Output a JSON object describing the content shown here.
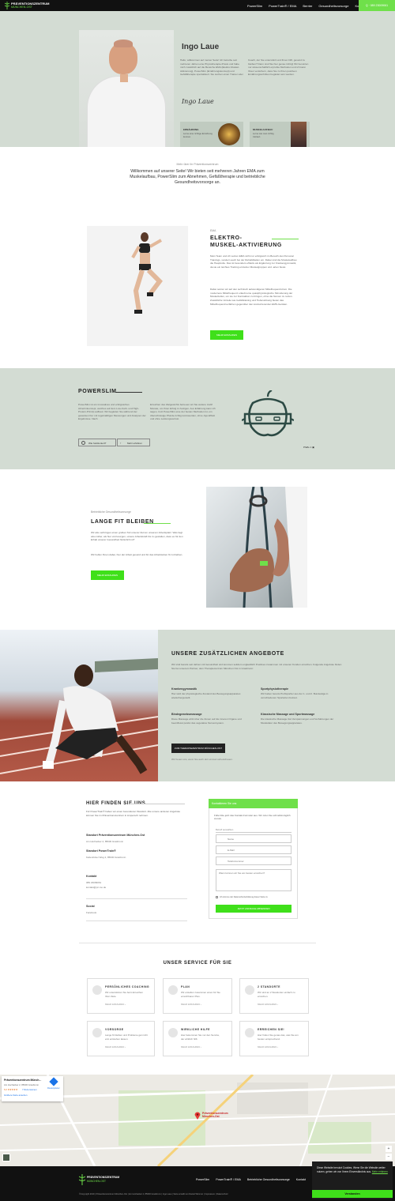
{
  "header": {
    "logo_line1": "PRÄVENTIONSZENTRUM",
    "logo_line2": "MÜNCHEN-OST",
    "nav": [
      "PowerSlim",
      "PowerTrain® / EMA",
      "Berrier",
      "Gesundheitsvorsorge",
      "Kontakt"
    ],
    "phone": "Q · 089 23009061"
  },
  "hero": {
    "name": "Ingo Laue",
    "col1": "Hallo, willkommen auf meiner Seite! Ich betreibe seit mehreren Jahren eine Physiotherapie-Praxis und habe mich zusätzlich auf die Bereiche EMA (Elektro-Muskel-Aktivierung), PowerSlim (Ernährungskonzept) und Gefäßtherapie spezialisiert. Sie suchen einen Trainer oder",
    "col2": "Coach, der Sie unterstützt und Ihnen hilft, gesund zu bleiben? Dann sind Sie hier genau richtig! Wir benutzen nur wissenschaftlich erprobte Methoden und ich kann Ihnen versichern, dass Sie zu Ihren positiven Ernährungsschritten begleitet sein werden.",
    "signature": "Ingo Laue",
    "tile1_title": "ERNÄHRUNG",
    "tile1_text": "Lerne eine richtige Ernährung kennen.",
    "tile2_title": "MUSKELAUFBAU",
    "tile2_text": "Lerne wie man richtig trainiert."
  },
  "intro": {
    "kicker": "Mehr über ihr Präventionszentrum",
    "text": "Willkommen auf unserer Seite! Wir bieten seit mehreren Jahren EMA zum Muskelaufbau, PowerSlim zum Abnehmen, Gefäßtherapie und betriebliche Gesundheitsvorsorge an."
  },
  "ema": {
    "kicker": "EMA",
    "title1": "ELEKTRO-",
    "title2": "MUSKEL-AKTIVIERUNG",
    "p1": "Mein Team und ich setzen EMA nicht nur erfolgreich im Bereich des Personal Trainings, sondern auch bei der Rehabilitation ein. Dabei sind die Muskelaufbau die Hauptrolle. Das ist besonders effektiv als Ergänzung zur Krankengymnastik, da sie ein leichtes Training einzelner Muskelgruppen und -arten bietet.",
    "p2": "Dabei setzen wir auf den technisch aufwendigeren Mittelfrequenzstrom. Die modernere Mittelfrequenz erlaubt eine quasiphysiologische Stimulierung der Muskelzellen, um sie zur Kontraktion zu bringen, ohne die Nerven zu reizen. Zusätzliche Vorteile wie Gefäßtraining und Tiefenwirkung bieten das Mittelfrequenzverfahren gegenüber den konkurrierenden EMS-Geräten.",
    "button": "MEHR ERFAHREN"
  },
  "powerslim": {
    "title": "POWERSLIM",
    "col1": "PowerSlim ist ein innovatives und erfolgreiches Abnehmkonzept, welches auf dem Low-Carb- und High-Protein-Prinzip aufbaut. Wir begleiten Sie während der gesamten Kur mit regelmäßigen Messungen und Analysen der Ergebnisse. Nach",
    "col2": "Erreichen des Zielgewichts betreuen wir Sie weitere zwölf Monate, um Ihren Erfolg zu festigen. Aus Erfahrung kann ich sagen, trotz PowerSlim eine der besten Methoden ist, um überschüssige Pfunde richtig loszuwerden, ohne Jojo-Effekt und ohne Leistungsverlust.",
    "link1": "Wie funktioniert?",
    "link2": "Mehr erfahren",
    "pager": "Pfaffe 1 ▣"
  },
  "bgv": {
    "kicker": "Betriebliche Gesundheitsvorsorge",
    "title": "LANGE FIT BLEIBEN",
    "p1": "Wir alle verbringen einen großen Teil unserer Zeit an unserem Arbeitsplatz. Was liegt also näher, als hier vorzusorgen, unsere Arbeitskraft bis zu gestalten, dass es für den Erhalt unserer Gesundheit förderlich ist?",
    "p2": "Wir helfen Ihnen dabei, hier der Arbeit gesund und für das Arbeitsleben fit zu bleiben.",
    "button": "MEHR ERFAHREN"
  },
  "offers": {
    "title": "UNSERE ZUSÄTZLICHEN ANGEBOTE",
    "intro": "Wir sind bereits seit Jahren mit Gesundheit und kommen seitdem unglaublich Positives zusammen mit unseren Kunden erreichen. Folgende Angebote finden Sie bei unserem Partner, dem Therapiezentrum München Ost in Grasbrunn:",
    "items": [
      {
        "title": "Krankengymnastik",
        "text": "Hier wird der physiologische Zustand des Bewegungsapparates wiederhergestellt."
      },
      {
        "title": "Sportphysiotherapie",
        "text": "Wir haben bereits Profisportler aus der 1. und 2. Bundesliga in verschiedenen Sportarten betreut."
      },
      {
        "title": "Bindegewebsmassage",
        "text": "Diese Massage wirkt über die Zonen auf die inneren Organe und beeinflusst positiv das vegetative Nervensystem."
      },
      {
        "title": "Klassische Massage und Sportmassage",
        "text": "Die klassische Massage löst Verspannungen und Verhärtungen der Muskulatur des Bewegungsapparates."
      }
    ],
    "button": "ZUM THERAPIEZENTRUM MÜNCHEN-OST",
    "note": "Wir freuen uns, wenn Sie auch dort einmal vorbeischauen."
  },
  "contact": {
    "title": "HIER FINDEN SIE UNS",
    "intro": "Für PowerTrain® haben wir einen besonderen Standort. Alle unsere anderen Angebote können Sie im Präventionszentrum in Ampersch nehmen.",
    "loc1_name": "Standort Präventionszentrum München-Ost",
    "loc1_addr": "Am Hochacker 2, 85630 Grasbrunn",
    "loc2_name": "Standort PowerTrain®",
    "loc2_addr": "Keltenricker Weg 2, 85630 Grasbrunn",
    "kontakt_label": "Kontakt",
    "phone": "089 23009061",
    "email": "kontakt@pz-mo.de",
    "social_label": "Social",
    "facebook": "Facebook",
    "form_title": "Kontaktieren Sie uns",
    "form_intro": "Fülle bitte jetzt das Kontakt-Formular aus. Wir rufen Sie schnellstmöglich zurück.",
    "ph_betreff": "Betreff auswählen",
    "ph_name": "Name",
    "ph_email": "E-Mail",
    "ph_phone": "Telefonnummer",
    "ph_message": "Wann können wir Sie am besten erreichen?",
    "consent": "Ich stimme der Datenschutzerklärung dieser Seite zu",
    "submit": "JETZT ANFRAGE ABSENDEN"
  },
  "services": {
    "title": "UNSER SERVICE FÜR SIE",
    "items": [
      {
        "title": "PERSÖNLICHES COACHING",
        "text": "Wir unterstützen Sie beim Erreichen Ihrer Ziele.",
        "more": "MEHR ERFAHREN ›"
      },
      {
        "title": "PLAN",
        "text": "Wir erstellen zusammen einen für Sie erreichbaren Plan.",
        "more": "MEHR ERFAHREN ›"
      },
      {
        "title": "2 STANDORTE",
        "text": "Wir sind an 2 Standorten einfach zu erreichen.",
        "more": "MEHR ERFAHREN ›"
      },
      {
        "title": "VORSORGE",
        "text": "Lange fit bleiben und Probleme gar nicht erst entstehen lassen.",
        "more": "MEHR ERFAHREN ›"
      },
      {
        "title": "WIRKLICHE HILFE",
        "text": "Hier bekommen Sie nur den Service, der wirklich hilft.",
        "more": "MEHR ERFAHREN ›"
      },
      {
        "title": "ERREICHEN SIE!",
        "text": "Hier finden Sie genau das, was Sie am besten entsprechend.",
        "more": "MEHR ERFAHREN ›"
      }
    ]
  },
  "map": {
    "place_name": "Präventionszentrum Münch...",
    "place_addr": "Am Hochacker 2, 85630 Grasbrunn",
    "rating": "5,0 ★★★★★",
    "reviews": "7 Rezensionen",
    "bigger": "Größere Karte ansehen",
    "route": "Routenplaner",
    "pin_label": "Präventionszentrum München-Ost",
    "zoom_in": "+",
    "zoom_out": "−"
  },
  "footer": {
    "nav": [
      "PowerSlim",
      "PowerTrain® / EMA",
      "Betriebliche Gesundheitsvorsorge",
      "Kontakt"
    ],
    "copyright": "©Copyright 2019 | Präventionszentrum München-Ost | Am Hochacker 2, 85630 Grasbrunn | Ingo Laue | Seite erstellt von Daniel Wimmer | Impressum | Datenschutz"
  },
  "cookie": {
    "text": "Diese Website benutzt Cookies. Wenn Sie die Website weiter nutzen, gehen wir von Ihrem Einverständnis aus.",
    "link": "Mehr erfahren",
    "button": "Verstanden"
  }
}
